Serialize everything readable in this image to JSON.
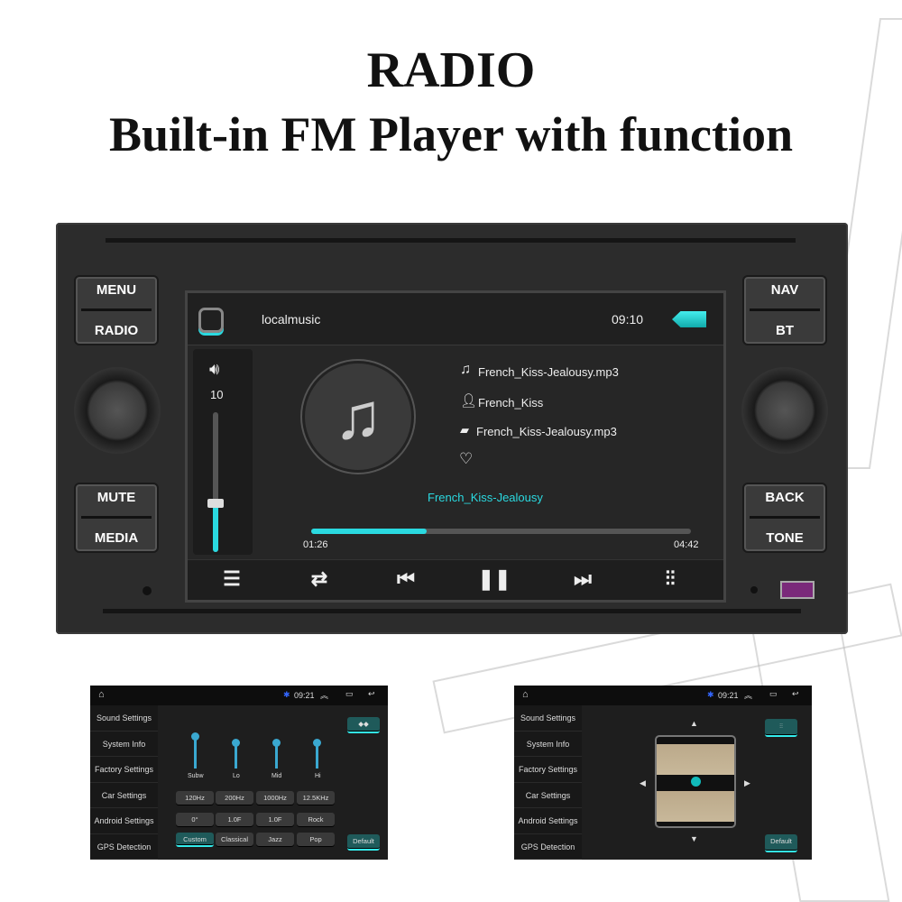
{
  "headline": {
    "title": "RADIO",
    "subtitle": "Built-in FM Player with function"
  },
  "head_unit": {
    "left_buttons": [
      {
        "top": "MENU",
        "bottom": "RADIO"
      },
      {
        "top": "MUTE",
        "bottom": "MEDIA"
      }
    ],
    "right_buttons": [
      {
        "top": "NAV",
        "bottom": "BT"
      },
      {
        "top": "BACK",
        "bottom": "TONE"
      }
    ]
  },
  "player": {
    "app_title": "localmusic",
    "clock": "09:10",
    "volume": {
      "value": "10",
      "level_fraction": 0.35
    },
    "track": {
      "file": "French_Kiss-Jealousy.mp3",
      "artist": "French_Kiss",
      "folder": "French_Kiss-Jealousy.mp3",
      "now_playing": "French_Kiss-Jealousy"
    },
    "progress": {
      "elapsed": "01:26",
      "total": "04:42",
      "fraction": 0.305
    },
    "controls": [
      "playlist-icon",
      "repeat-icon",
      "previous-icon",
      "pause-icon",
      "next-icon",
      "equalizer-icon"
    ],
    "accent": "#2ad9e0"
  },
  "settings_screens": {
    "clock": "09:21",
    "menu": [
      "Sound Settings",
      "System Info",
      "Factory Settings",
      "Car Settings",
      "Android Settings",
      "GPS Detection"
    ],
    "eq": {
      "bands": [
        "Subw",
        "Lo",
        "Mid",
        "Hi"
      ],
      "freq": [
        "120Hz",
        "200Hz",
        "1000Hz",
        "12.5KHz"
      ],
      "q": [
        "0°",
        "1.0F",
        "1.0F",
        "Rock"
      ],
      "presets": [
        "Custom",
        "Classical",
        "Jazz",
        "Pop"
      ],
      "active_preset": "Custom",
      "default_label": "Default"
    },
    "balance": {
      "default_label": "Default"
    }
  }
}
